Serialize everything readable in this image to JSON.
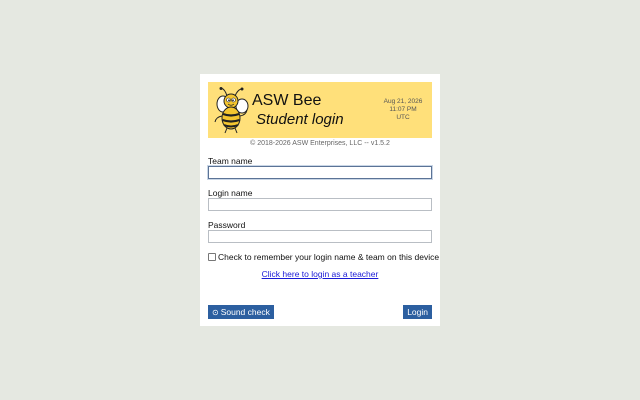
{
  "banner": {
    "app_name": "ASW Bee",
    "subtitle": "Student login",
    "date": "Aug 21, 2026",
    "time": "11:07 PM",
    "timezone": "UTC",
    "mascot_icon": "bee-mascot-icon",
    "background_color": "#ffe07a"
  },
  "copyright": "© 2018-2026 ASW Enterprises, LLC -- v1.5.2",
  "form": {
    "team_label": "Team name",
    "team_value": "",
    "login_label": "Login name",
    "login_value": "",
    "password_label": "Password",
    "password_value": "",
    "remember_label": "Check to remember your login name & team on this device",
    "remember_checked": false,
    "teacher_link": "Click here to login as a teacher"
  },
  "buttons": {
    "sound_check_icon": "play-circle-icon",
    "sound_check": "Sound check",
    "login": "Login",
    "accent_color": "#2c5fa0"
  }
}
